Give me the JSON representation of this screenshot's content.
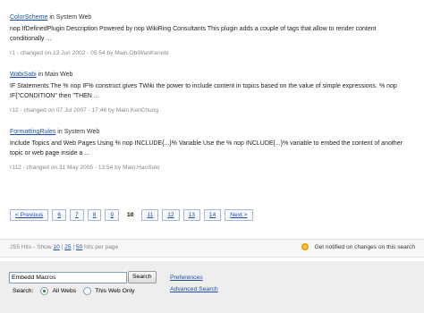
{
  "results": [
    {
      "topic": "ColorScheme",
      "web_text": " in System Web",
      "snippet": "nop IfDefinedPlugin Description Powered by nop WikiRing Consultants This plugin adds a couple of tags that allow to render content conditionally ...",
      "meta": "r1 - changed on 13 Jun 2002 - 05:54 by Main.ObiWanKenobi"
    },
    {
      "topic": "WabiSabi",
      "web_text": " in Main Web",
      "snippet": "IF Statements The % nop IF% construct gives TWiki the power to include content in topics based on the value of simple expressions. % nop IF{\"CONDITION\" then \"THEN ...",
      "meta": "r12 - changed on 07 Jul 2007 - 17:46 by Main.KenChung"
    },
    {
      "topic": "FormattingRules",
      "web_text": " in System Web",
      "snippet": "Include Topics and Web Pages Using % nop INCLUDE{...}% Variable Use the % nop INCLUDE{...}% variable to embed the content of another topic or web page inside a ...",
      "meta": "r112 - changed on 31 May 2005 - 13:54 by Main.HanSolo"
    }
  ],
  "pager": {
    "previous": "< Previous",
    "pages": [
      "6",
      "7",
      "8",
      "9",
      "10",
      "11",
      "12",
      "13",
      "14"
    ],
    "current": "10",
    "next": "Next >"
  },
  "hitbar": {
    "hits": "255 Hits",
    "show_label": "- Show",
    "opt_10": "10",
    "opt_25": "25",
    "opt_50": "50",
    "per_page": "hits per page",
    "notify": "Get notified on changes on this search"
  },
  "search": {
    "query": "Embedd Macros",
    "button": "Search",
    "scope_label": "Search:",
    "all_webs": "All Webs",
    "this_web": "This Web Only",
    "preferences": "Preferences",
    "advanced": "Advanced Search"
  },
  "icons": {
    "notify": "rss-feed-icon"
  }
}
